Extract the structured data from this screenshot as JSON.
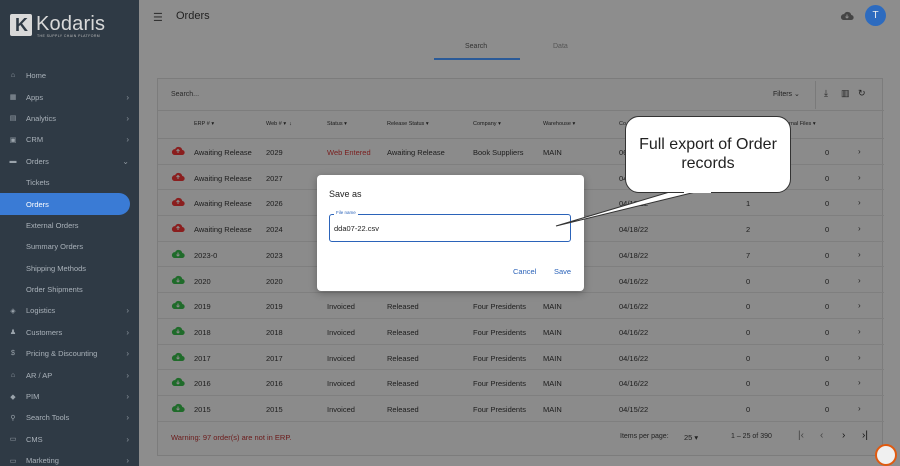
{
  "brand": {
    "name": "Kodaris",
    "tagline": "THE SUPPLY CHAIN PLATFORM",
    "logo_letter": "K"
  },
  "sidebar": {
    "items": [
      {
        "label": "Home",
        "icon": "home-icon",
        "chevron": false
      },
      {
        "label": "Apps",
        "icon": "apps-icon",
        "chevron": true
      },
      {
        "label": "Analytics",
        "icon": "analytics-icon",
        "chevron": true
      },
      {
        "label": "CRM",
        "icon": "crm-icon",
        "chevron": true
      },
      {
        "label": "Orders",
        "icon": "orders-icon",
        "chevron": true,
        "expanded": true
      },
      {
        "label": "Tickets",
        "sub": true
      },
      {
        "label": "Orders",
        "sub": true,
        "active": true
      },
      {
        "label": "External Orders",
        "sub": true
      },
      {
        "label": "Summary Orders",
        "sub": true
      },
      {
        "label": "Shipping Methods",
        "sub": true
      },
      {
        "label": "Order Shipments",
        "sub": true
      },
      {
        "label": "Logistics",
        "icon": "logistics-icon",
        "chevron": true
      },
      {
        "label": "Customers",
        "icon": "customers-icon",
        "chevron": true
      },
      {
        "label": "Pricing & Discounting",
        "icon": "dollar-icon",
        "chevron": true
      },
      {
        "label": "AR / AP",
        "icon": "bank-icon",
        "chevron": true
      },
      {
        "label": "PIM",
        "icon": "tag-icon",
        "chevron": true
      },
      {
        "label": "Search Tools",
        "icon": "search-icon",
        "chevron": true
      },
      {
        "label": "CMS",
        "icon": "cms-icon",
        "chevron": true
      },
      {
        "label": "Marketing",
        "icon": "marketing-icon",
        "chevron": true
      }
    ]
  },
  "header": {
    "title": "Orders",
    "avatar_letter": "T"
  },
  "tabs": [
    {
      "label": "Search",
      "active": true
    },
    {
      "label": "Data",
      "active": false
    }
  ],
  "toolbar": {
    "search_placeholder": "Search...",
    "filters_label": "Filters"
  },
  "table": {
    "columns": [
      "ERP #",
      "Web #",
      "Status",
      "Release Status",
      "Company",
      "Warehouse",
      "Co",
      "rnal Files"
    ],
    "rows": [
      {
        "cloud": "red",
        "erp": "Awaiting Release",
        "web": "2029",
        "status": "Web Entered",
        "status_red": true,
        "release": "Awaiting Release",
        "company": "Book Suppliers",
        "warehouse": "MAIN",
        "date": "06",
        "files": "",
        "ext": "0"
      },
      {
        "cloud": "red",
        "erp": "Awaiting Release",
        "web": "2027",
        "status": "",
        "release": "",
        "company": "",
        "warehouse": "",
        "date": "04",
        "files": "",
        "ext": "0"
      },
      {
        "cloud": "red",
        "erp": "Awaiting Release",
        "web": "2026",
        "status": "",
        "release": "",
        "company": "",
        "warehouse": "",
        "date": "04/18/22",
        "files": "1",
        "ext": "0"
      },
      {
        "cloud": "red",
        "erp": "Awaiting Release",
        "web": "2024",
        "status": "",
        "release": "",
        "company": "",
        "warehouse": "",
        "date": "04/18/22",
        "files": "2",
        "ext": "0"
      },
      {
        "cloud": "green",
        "erp": "2023-0",
        "web": "2023",
        "status": "",
        "release": "",
        "company": "",
        "warehouse": "",
        "date": "04/18/22",
        "files": "7",
        "ext": "0"
      },
      {
        "cloud": "green",
        "erp": "2020",
        "web": "2020",
        "status": "",
        "release": "",
        "company": "",
        "warehouse": "",
        "date": "04/16/22",
        "files": "0",
        "ext": "0"
      },
      {
        "cloud": "green",
        "erp": "2019",
        "web": "2019",
        "status": "Invoiced",
        "release": "Released",
        "company": "Four Presidents",
        "warehouse": "MAIN",
        "date": "04/16/22",
        "files": "0",
        "ext": "0"
      },
      {
        "cloud": "green",
        "erp": "2018",
        "web": "2018",
        "status": "Invoiced",
        "release": "Released",
        "company": "Four Presidents",
        "warehouse": "MAIN",
        "date": "04/16/22",
        "files": "0",
        "ext": "0"
      },
      {
        "cloud": "green",
        "erp": "2017",
        "web": "2017",
        "status": "Invoiced",
        "release": "Released",
        "company": "Four Presidents",
        "warehouse": "MAIN",
        "date": "04/16/22",
        "files": "0",
        "ext": "0"
      },
      {
        "cloud": "green",
        "erp": "2016",
        "web": "2016",
        "status": "Invoiced",
        "release": "Released",
        "company": "Four Presidents",
        "warehouse": "MAIN",
        "date": "04/16/22",
        "files": "0",
        "ext": "0"
      },
      {
        "cloud": "green",
        "erp": "2015",
        "web": "2015",
        "status": "Invoiced",
        "release": "Released",
        "company": "Four Presidents",
        "warehouse": "MAIN",
        "date": "04/15/22",
        "files": "0",
        "ext": "0"
      }
    ]
  },
  "footer": {
    "warning": "Warning: 97 order(s) are not in ERP.",
    "items_per_page_label": "Items per page:",
    "items_per_page": "25",
    "range": "1 – 25 of 390"
  },
  "dialog": {
    "title": "Save as",
    "field_label": "File name",
    "field_value": "dda07-22.csv",
    "cancel": "Cancel",
    "save": "Save"
  },
  "callout": {
    "text": "Full export of Order records"
  },
  "colors": {
    "sidebar_bg": "#2f3a45",
    "accent": "#3a7bd5",
    "cloud_red": "#8a1e1e",
    "cloud_green": "#1f6b2a"
  }
}
